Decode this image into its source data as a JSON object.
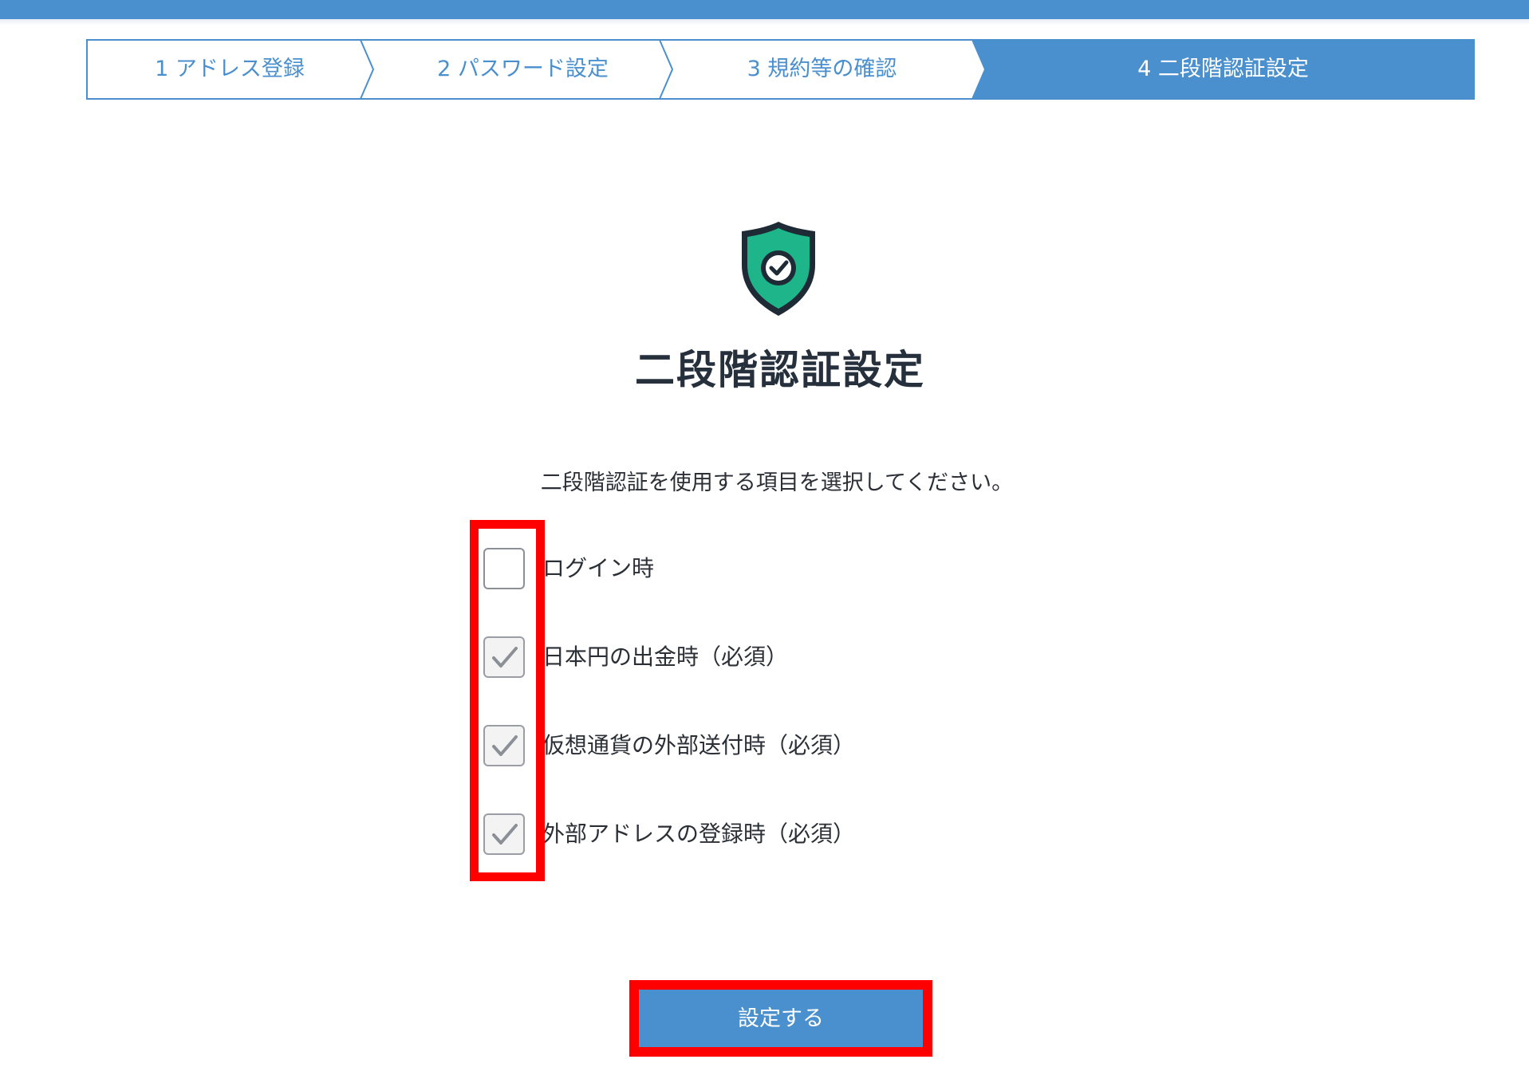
{
  "colors": {
    "accent": "#4a8fce",
    "shield_green": "#1fb58a",
    "shield_dark": "#1e2a36",
    "highlight": "#ff0000"
  },
  "stepper": {
    "steps": [
      {
        "label": "1 アドレス登録",
        "active": false
      },
      {
        "label": "2 パスワード設定",
        "active": false
      },
      {
        "label": "3 規約等の確認",
        "active": false
      },
      {
        "label": "4 二段階認証設定",
        "active": true
      }
    ]
  },
  "main": {
    "icon": "shield-check-icon",
    "title": "二段階認証設定",
    "instruction": "二段階認証を使用する項目を選択してください。",
    "options": [
      {
        "label": "ログイン時",
        "checked": false,
        "disabled": false
      },
      {
        "label": "日本円の出金時（必須）",
        "checked": true,
        "disabled": true
      },
      {
        "label": "仮想通貨の外部送付時（必須）",
        "checked": true,
        "disabled": true
      },
      {
        "label": "外部アドレスの登録時（必須）",
        "checked": true,
        "disabled": true
      }
    ],
    "submit_label": "設定する"
  }
}
